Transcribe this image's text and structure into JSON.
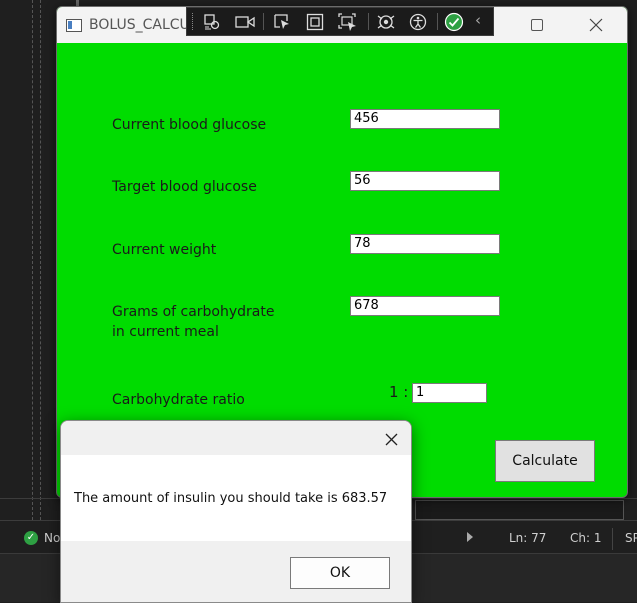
{
  "window": {
    "title": "BOLUS_CALCU",
    "background_color": "#00dc00"
  },
  "debug_toolbar": {
    "icons": [
      "select-element-icon",
      "live-visual-tree-icon",
      "select-icon",
      "display-layout-adorners-icon",
      "track-focus-icon",
      "hot-reload-icon",
      "accessibility-icon",
      "binding-ok-icon",
      "collapse-chevron-icon"
    ]
  },
  "form": {
    "current_glucose": {
      "label": "Current blood glucose",
      "value": "456"
    },
    "target_glucose": {
      "label": "Target blood glucose",
      "value": "56"
    },
    "weight": {
      "label": "Current weight",
      "value": "78"
    },
    "carbs": {
      "label_line1": "Grams of carbohydrate",
      "label_line2": "in current meal",
      "value": "678"
    },
    "ratio": {
      "label": "Carbohydrate ratio",
      "prefix": "1 :",
      "value": "1"
    },
    "calculate_label": "Calculate"
  },
  "dialog": {
    "message": "The amount of insulin you should take is 683.57",
    "ok_label": "OK"
  },
  "status_bar": {
    "issues_text": "No",
    "line": "Ln: 77",
    "char": "Ch: 1",
    "encoding": "SP"
  }
}
